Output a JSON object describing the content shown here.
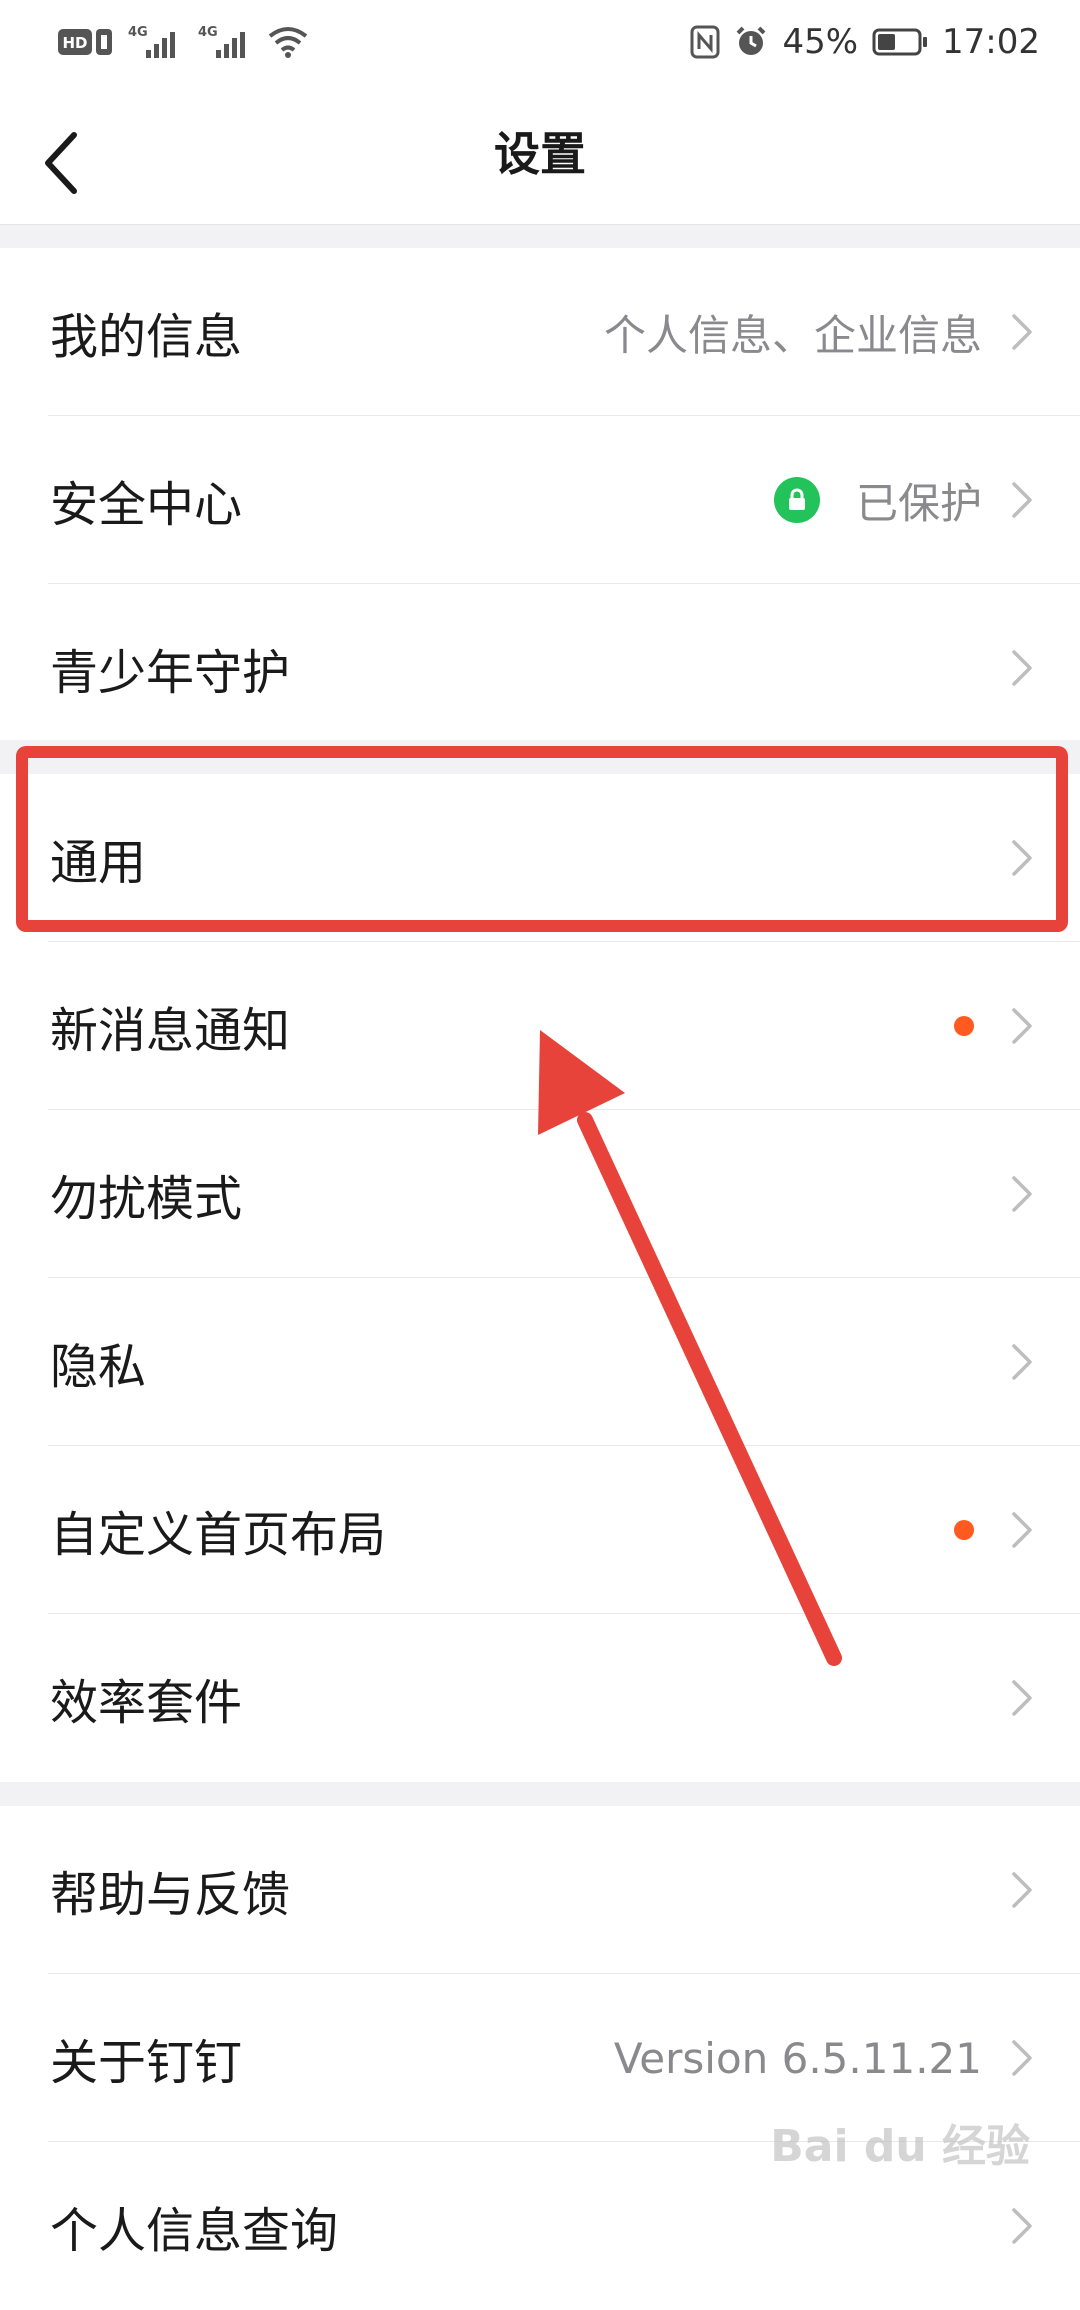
{
  "status_bar": {
    "hd_label": "HD",
    "net1": "4G",
    "net2": "4G",
    "battery_pct": "45%",
    "time": "17:02",
    "battery_level": 0.45
  },
  "header": {
    "title": "设置"
  },
  "groups": [
    {
      "items": [
        {
          "label": "我的信息",
          "value": "个人信息、企业信息"
        },
        {
          "label": "安全中心",
          "value": "已保护",
          "icon": "lock-icon",
          "icon_color": "#21c35a"
        },
        {
          "label": "青少年守护"
        }
      ]
    },
    {
      "items": [
        {
          "label": "通用"
        },
        {
          "label": "新消息通知",
          "badge": "dot"
        },
        {
          "label": "勿扰模式"
        },
        {
          "label": "隐私"
        },
        {
          "label": "自定义首页布局",
          "badge": "dot"
        },
        {
          "label": "效率套件"
        }
      ]
    },
    {
      "items": [
        {
          "label": "帮助与反馈"
        },
        {
          "label": "关于钉钉",
          "value": "Version 6.5.11.21"
        },
        {
          "label": "个人信息查询"
        }
      ]
    }
  ],
  "colors": {
    "accent_red": "#e8433a",
    "badge_dot": "#ff5a1f",
    "secure_green": "#21c35a"
  },
  "watermark": "Bai du 经验"
}
